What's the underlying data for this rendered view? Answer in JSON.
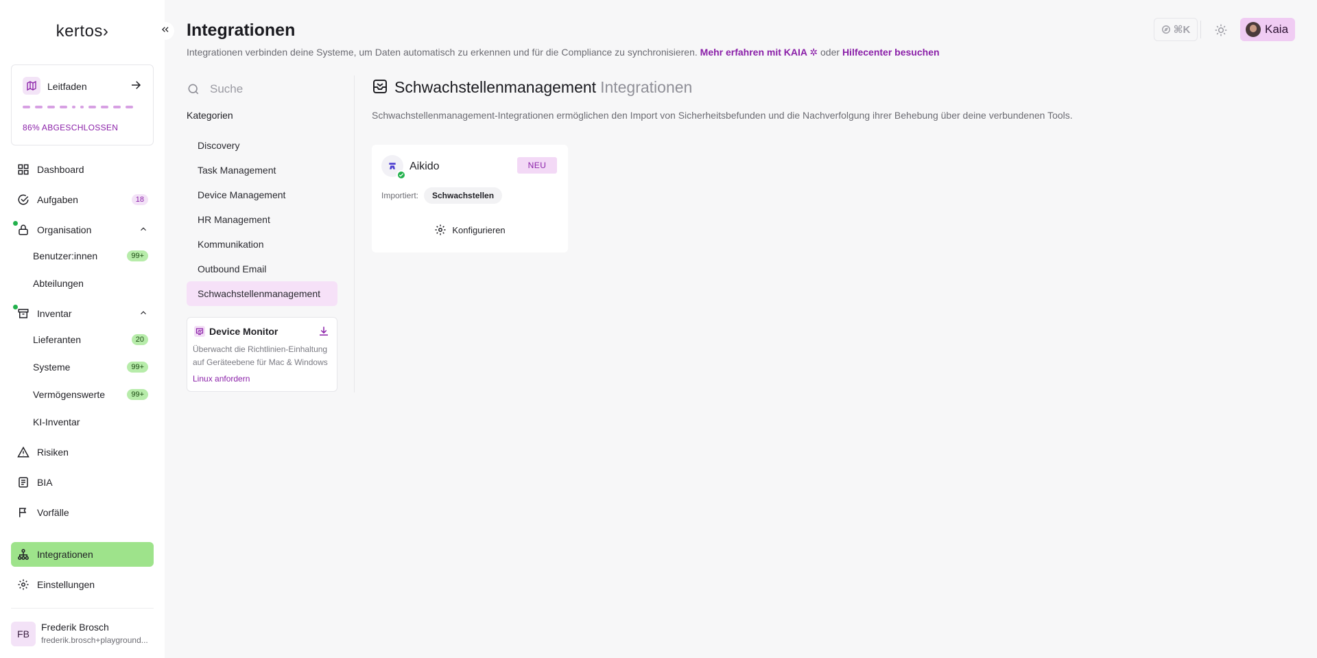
{
  "sidebar": {
    "logo": "kertos›",
    "guide": {
      "label": "Leitfaden",
      "status": "86% ABGESCHLOSSEN",
      "progress": 0.86
    },
    "items": [
      {
        "label": "Dashboard",
        "icon": "dashboard-icon"
      },
      {
        "label": "Aufgaben",
        "icon": "check-circle-icon",
        "badge": "18"
      },
      {
        "label": "Organisation",
        "icon": "lock-icon"
      },
      {
        "label": "Benutzer:innen",
        "badge": "99+"
      },
      {
        "label": "Abteilungen"
      },
      {
        "label": "Inventar",
        "icon": "archive-icon"
      },
      {
        "label": "Lieferanten",
        "badge": "20"
      },
      {
        "label": "Systeme",
        "badge": "99+"
      },
      {
        "label": "Vermögenswerte",
        "badge": "99+"
      },
      {
        "label": "KI-Inventar"
      },
      {
        "label": "Risiken",
        "icon": "warning-icon"
      },
      {
        "label": "BIA",
        "icon": "document-icon"
      },
      {
        "label": "Vorfälle",
        "icon": "flag-icon"
      },
      {
        "label": "Integrationen",
        "icon": "network-icon"
      },
      {
        "label": "Einstellungen",
        "icon": "gear-icon"
      }
    ],
    "user": {
      "initials": "FB",
      "name": "Frederik Brosch",
      "email": "frederik.brosch+playground..."
    }
  },
  "header": {
    "title": "Integrationen",
    "description": "Integrationen verbinden deine Systeme, um Daten automatisch zu erkennen und für die Compliance zu synchronisieren.",
    "link_kaia": "Mehr erfahren mit KAIA",
    "connector": "oder",
    "link_help": "Hilfecenter besuchen",
    "shortcut_label": "⌘K",
    "assistant_label": "Kaia"
  },
  "categories": {
    "search_placeholder": "Suche",
    "heading": "Kategorien",
    "items": [
      "Discovery",
      "Task Management",
      "Device Management",
      "HR Management",
      "Kommunikation",
      "Outbound Email",
      "Schwachstellenmanagement"
    ]
  },
  "device_monitor": {
    "title": "Device Monitor",
    "text": "Überwacht die Richtlinien-Einhaltung auf Geräteebene für Mac & Windows",
    "link": "Linux anfordern"
  },
  "main": {
    "section_title": "Schwachstellenmanagement",
    "section_subtitle": "Integrationen",
    "section_desc": "Schwachstellenmanagement-Integrationen ermöglichen den Import von Sicherheitsbefunden und die Nachverfolgung ihrer Behebung über deine verbundenen Tools.",
    "integration": {
      "name": "Aikido",
      "badge": "NEU",
      "imports_label": "Importiert:",
      "imports_chip": "Schwachstellen",
      "configure_label": "Konfigurieren"
    }
  },
  "colors": {
    "accent": "#8a1fa8",
    "active_nav": "#9ee38b",
    "active_category": "#f6e1f8",
    "badge_green": "#b7ecaa"
  }
}
